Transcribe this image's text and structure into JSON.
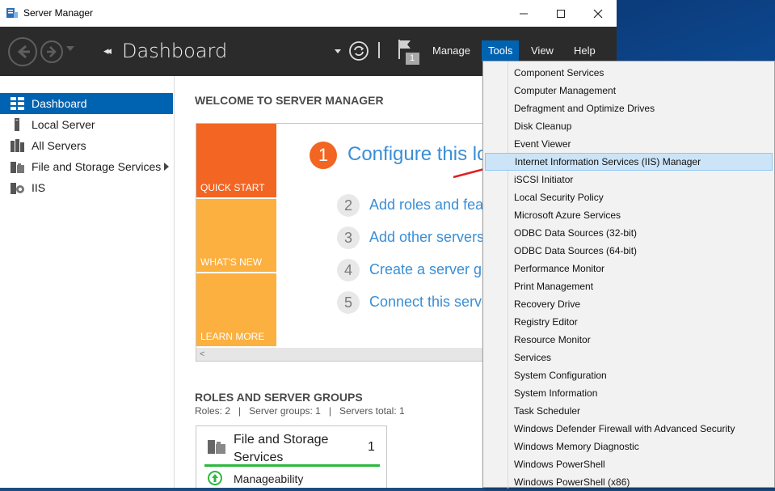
{
  "window": {
    "title": "Server Manager"
  },
  "header": {
    "breadcrumb": "Dashboard",
    "notification_count": "1",
    "menu": [
      "Manage",
      "Tools",
      "View",
      "Help"
    ],
    "active_menu": "Tools"
  },
  "sidebar": {
    "items": [
      {
        "label": "Dashboard",
        "icon": "dashboard-icon",
        "active": true
      },
      {
        "label": "Local Server",
        "icon": "server-icon"
      },
      {
        "label": "All Servers",
        "icon": "servers-icon"
      },
      {
        "label": "File and Storage Services",
        "icon": "storage-icon",
        "has_submenu": true
      },
      {
        "label": "IIS",
        "icon": "iis-icon"
      }
    ]
  },
  "main": {
    "welcome_title": "WELCOME TO SERVER MANAGER",
    "tiles": [
      "QUICK START",
      "WHAT'S NEW",
      "LEARN MORE"
    ],
    "step1": {
      "number": "1",
      "text": "Configure this local server"
    },
    "steps": [
      {
        "number": "2",
        "text": "Add roles and features"
      },
      {
        "number": "3",
        "text": "Add other servers to manage"
      },
      {
        "number": "4",
        "text": "Create a server group"
      },
      {
        "number": "5",
        "text": "Connect this server to cloud services"
      }
    ],
    "roles_title": "ROLES AND SERVER GROUPS",
    "roles_stats": "Roles: 2   |   Server groups: 1   |   Servers total: 1",
    "role_card": {
      "name": "File and Storage Services",
      "count": "1",
      "status": "Manageability"
    }
  },
  "tools_menu": {
    "items": [
      "Component Services",
      "Computer Management",
      "Defragment and Optimize Drives",
      "Disk Cleanup",
      "Event Viewer",
      "Internet Information Services (IIS) Manager",
      "iSCSI Initiator",
      "Local Security Policy",
      "Microsoft Azure Services",
      "ODBC Data Sources (32-bit)",
      "ODBC Data Sources (64-bit)",
      "Performance Monitor",
      "Print Management",
      "Recovery Drive",
      "Registry Editor",
      "Resource Monitor",
      "Services",
      "System Configuration",
      "System Information",
      "Task Scheduler",
      "Windows Defender Firewall with Advanced Security",
      "Windows Memory Diagnostic",
      "Windows PowerShell",
      "Windows PowerShell (x86)"
    ],
    "highlighted": "Internet Information Services (IIS) Manager"
  },
  "colors": {
    "accent": "#0063b1",
    "quick_start": "#f26522",
    "tile_secondary": "#fcb040",
    "link": "#3a8ed6",
    "highlight": "#cce4f7"
  }
}
